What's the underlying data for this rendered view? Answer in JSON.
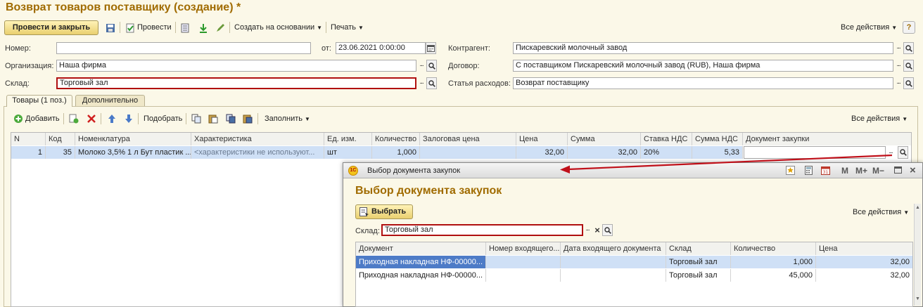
{
  "window": {
    "title": "Возврат товаров поставщику (создание) *"
  },
  "toolbar": {
    "post_close": "Провести и закрыть",
    "post": "Провести",
    "create_based": "Создать на основании",
    "print": "Печать",
    "all_actions": "Все действия"
  },
  "header": {
    "number_label": "Номер:",
    "number_value": "",
    "date_label": "от:",
    "date_value": "23.06.2021  0:00:00",
    "org_label": "Организация:",
    "org_value": "Наша фирма",
    "warehouse_label": "Склад:",
    "warehouse_value": "Торговый зал",
    "counterparty_label": "Контрагент:",
    "counterparty_value": "Пискаревский молочный завод",
    "contract_label": "Договор:",
    "contract_value": "С поставщиком Пискаревский молочный завод (RUB), Наша фирма",
    "expense_label": "Статья расходов:",
    "expense_value": "Возврат поставщику"
  },
  "tabs": [
    {
      "label": "Товары (1 поз.)",
      "active": true
    },
    {
      "label": "Дополнительно",
      "active": false
    }
  ],
  "goods_toolbar": {
    "add": "Добавить",
    "pick": "Подобрать",
    "fill": "Заполнить",
    "all_actions": "Все действия"
  },
  "goods_table": {
    "columns": [
      "N",
      "Код",
      "Номенклатура",
      "Характеристика",
      "Ед. изм.",
      "Количество",
      "Залоговая цена",
      "Цена",
      "Сумма",
      "Ставка НДС",
      "Сумма НДС",
      "Документ закупки"
    ],
    "rows": [
      [
        "1",
        "35",
        "Молоко 3,5% 1 л Бут пластик ...",
        "<характеристики не используют...",
        "шт",
        "1,000",
        "",
        "32,00",
        "32,00",
        "20%",
        "5,33",
        ""
      ]
    ]
  },
  "popup": {
    "title": "Выбор документа закупок",
    "heading": "Выбор документа закупок",
    "choose": "Выбрать",
    "all_actions": "Все действия",
    "warehouse_label": "Склад:",
    "warehouse_value": "Торговый зал",
    "header_buttons": [
      "M",
      "M+",
      "M−"
    ],
    "columns": [
      "Документ",
      "Номер входящего...",
      "Дата входящего документа",
      "Склад",
      "Количество",
      "Цена"
    ],
    "rows": [
      [
        "Приходная накладная НФ-00000...",
        "",
        "",
        "Торговый зал",
        "1,000",
        "32,00"
      ],
      [
        "Приходная накладная НФ-00000...",
        "",
        "",
        "Торговый зал",
        "45,000",
        "32,00"
      ]
    ]
  },
  "colors": {
    "accent": "#a06b00",
    "highlight": "#b01010",
    "selection": "#cfe0f6"
  }
}
